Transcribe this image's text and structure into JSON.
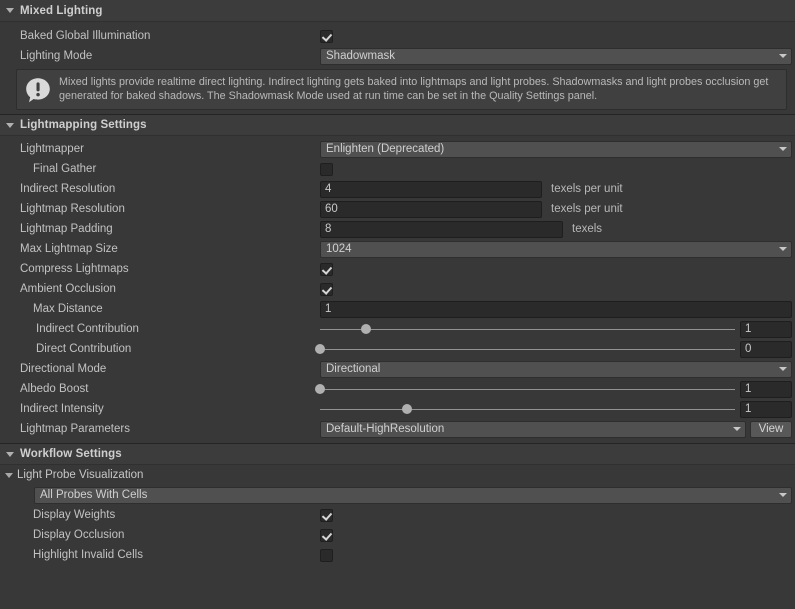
{
  "sections": {
    "mixed_lighting": {
      "title": "Mixed Lighting",
      "rows": {
        "baked_gi": {
          "label": "Baked Global Illumination",
          "checked": true
        },
        "lighting_mode": {
          "label": "Lighting Mode",
          "value": "Shadowmask"
        }
      },
      "helpbox": {
        "icon": "info-icon",
        "text": "Mixed lights provide realtime direct lighting. Indirect lighting gets baked into lightmaps and light probes. Shadowmasks and light probes occlusion get generated for baked shadows. The Shadowmask Mode used at run time can be set in the Quality Settings panel."
      }
    },
    "lightmapping_settings": {
      "title": "Lightmapping Settings",
      "rows": {
        "lightmapper": {
          "label": "Lightmapper",
          "value": "Enlighten (Deprecated)"
        },
        "final_gather": {
          "label": "Final Gather",
          "checked": false
        },
        "indirect_resolution": {
          "label": "Indirect Resolution",
          "value": "4",
          "unit": "texels per unit"
        },
        "lightmap_resolution": {
          "label": "Lightmap Resolution",
          "value": "60",
          "unit": "texels per unit"
        },
        "lightmap_padding": {
          "label": "Lightmap Padding",
          "value": "8",
          "unit": "texels"
        },
        "max_lightmap_size": {
          "label": "Max Lightmap Size",
          "value": "1024"
        },
        "compress_lightmaps": {
          "label": "Compress Lightmaps",
          "checked": true
        },
        "ambient_occlusion": {
          "label": "Ambient Occlusion",
          "checked": true
        },
        "max_distance": {
          "label": "Max Distance",
          "value": "1"
        },
        "indirect_contribution": {
          "label": "Indirect Contribution",
          "value": "1",
          "slider_pct": 11
        },
        "direct_contribution": {
          "label": "Direct Contribution",
          "value": "0",
          "slider_pct": 0
        },
        "directional_mode": {
          "label": "Directional Mode",
          "value": "Directional"
        },
        "albedo_boost": {
          "label": "Albedo Boost",
          "value": "1",
          "slider_pct": 0
        },
        "indirect_intensity": {
          "label": "Indirect Intensity",
          "value": "1",
          "slider_pct": 21
        },
        "lightmap_parameters": {
          "label": "Lightmap Parameters",
          "value": "Default-HighResolution",
          "button": "View"
        }
      }
    },
    "workflow_settings": {
      "title": "Workflow Settings",
      "light_probe_visualization": {
        "title": "Light Probe Visualization",
        "mode": "All Probes With Cells",
        "rows": {
          "display_weights": {
            "label": "Display Weights",
            "checked": true
          },
          "display_occlusion": {
            "label": "Display Occlusion",
            "checked": true
          },
          "highlight_invalid_cells": {
            "label": "Highlight Invalid Cells",
            "checked": false
          }
        }
      }
    }
  },
  "colors": {
    "panel_bg": "#383838",
    "header_bg": "#3c3c3c",
    "dropdown_bg": "#505050",
    "field_bg": "#2a2a2a",
    "text": "#c2c2c2"
  }
}
